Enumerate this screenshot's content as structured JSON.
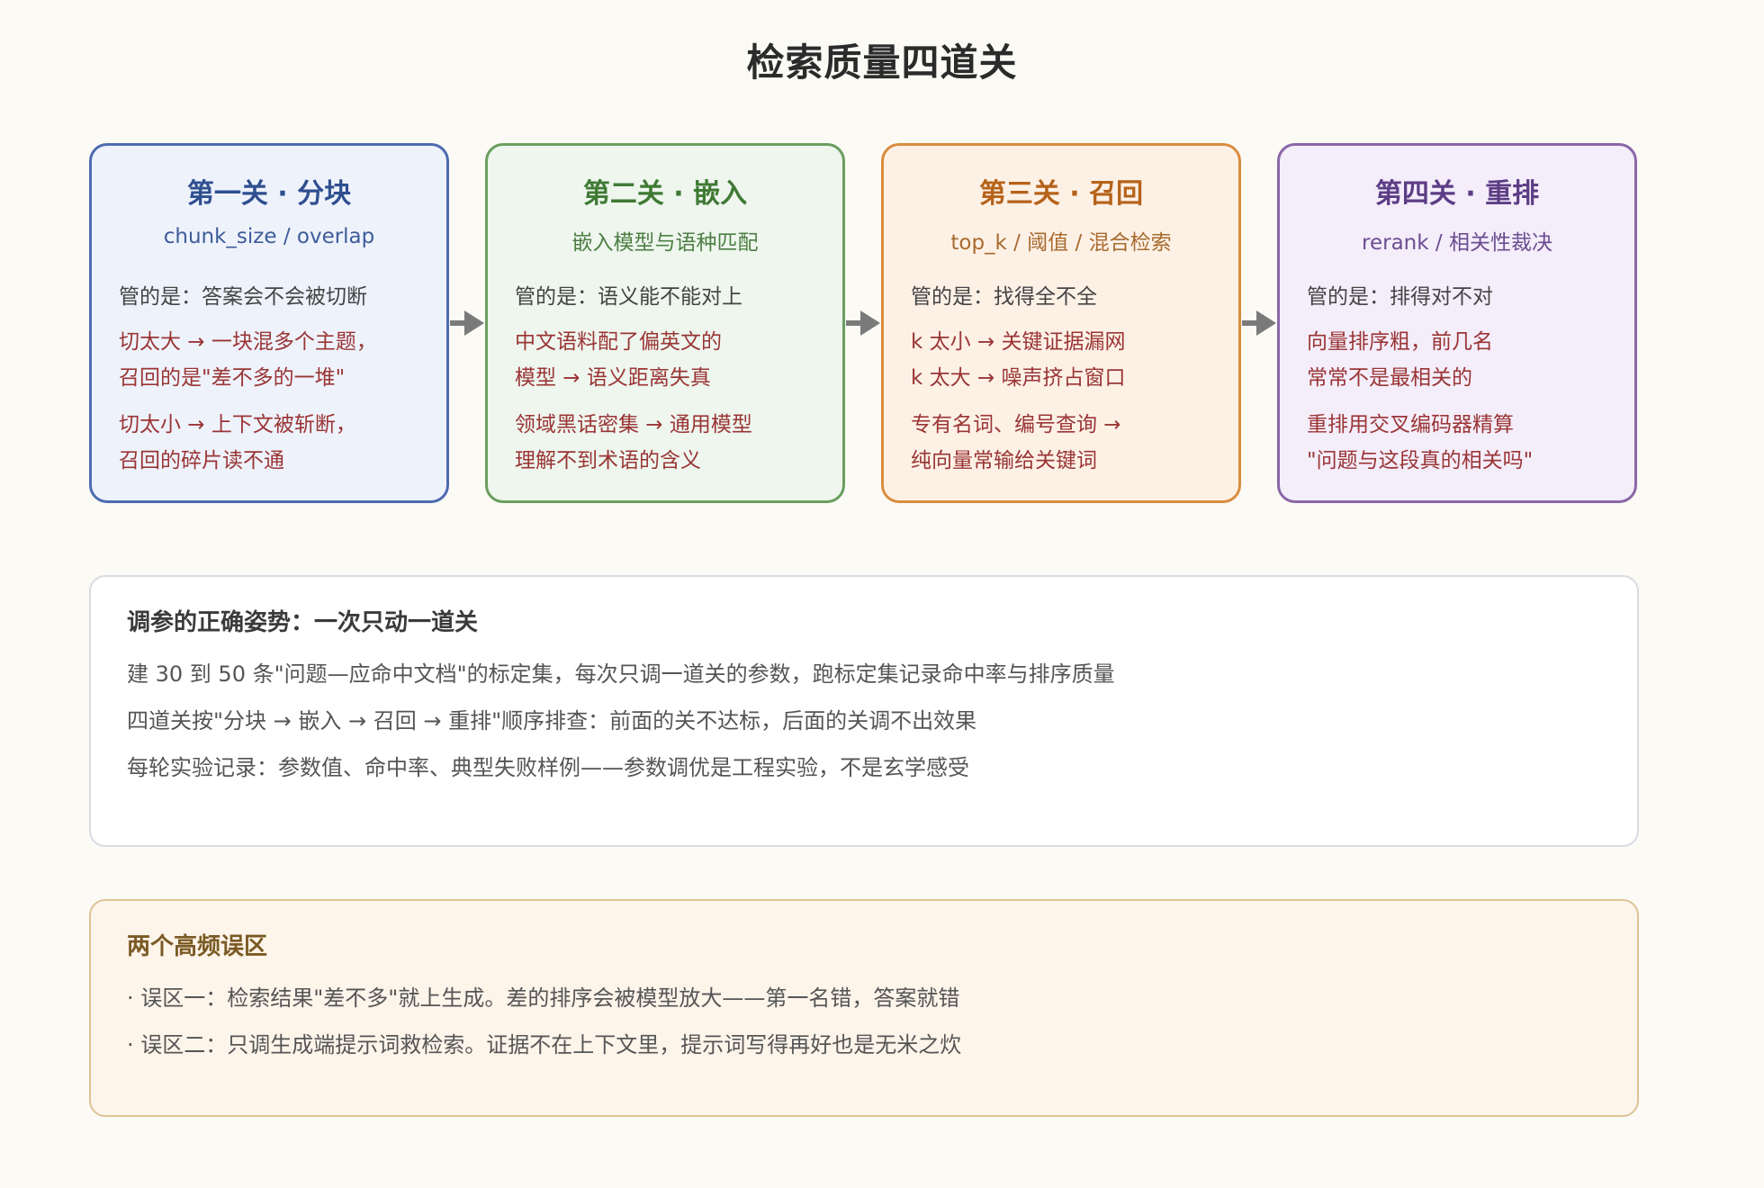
{
  "title": "检索质量四道关",
  "stages": [
    {
      "title": "第一关 · 分块",
      "subtitle": "chunk_size / overlap",
      "focus": "管的是：答案会不会被切断",
      "point1": "切太大 → 一块混多个主题，\n召回的是\"差不多的一堆\"",
      "point2": "切太小 → 上下文被斩断，\n召回的碎片读不通"
    },
    {
      "title": "第二关 · 嵌入",
      "subtitle": "嵌入模型与语种匹配",
      "focus": "管的是：语义能不能对上",
      "point1": "中文语料配了偏英文的\n模型 → 语义距离失真",
      "point2": "领域黑话密集 → 通用模型\n理解不到术语的含义"
    },
    {
      "title": "第三关 · 召回",
      "subtitle": "top_k / 阈值 / 混合检索",
      "focus": "管的是：找得全不全",
      "point1": "k 太小 → 关键证据漏网\nk 太大 → 噪声挤占窗口",
      "point2": "专有名词、编号查询 →\n纯向量常输给关键词"
    },
    {
      "title": "第四关 · 重排",
      "subtitle": "rerank / 相关性裁决",
      "focus": "管的是：排得对不对",
      "point1": "向量排序粗，前几名\n常常不是最相关的",
      "point2": "重排用交叉编码器精算\n\"问题与这段真的相关吗\""
    }
  ],
  "tuning": {
    "heading": "调参的正确姿势：一次只动一道关",
    "lines": [
      "建 30 到 50 条\"问题—应命中文档\"的标定集，每次只调一道关的参数，跑标定集记录命中率与排序质量",
      "四道关按\"分块 → 嵌入 → 召回 → 重排\"顺序排查：前面的关不达标，后面的关调不出效果",
      "每轮实验记录：参数值、命中率、典型失败样例——参数调优是工程实验，不是玄学感受"
    ]
  },
  "pitfalls": {
    "heading": "两个高频误区",
    "lines": [
      "· 误区一：检索结果\"差不多\"就上生成。差的排序会被模型放大——第一名错，答案就错",
      "· 误区二：只调生成端提示词救检索。证据不在上下文里，提示词写得再好也是无米之炊"
    ]
  },
  "colors": {
    "arrow": "#7a7a7a"
  }
}
